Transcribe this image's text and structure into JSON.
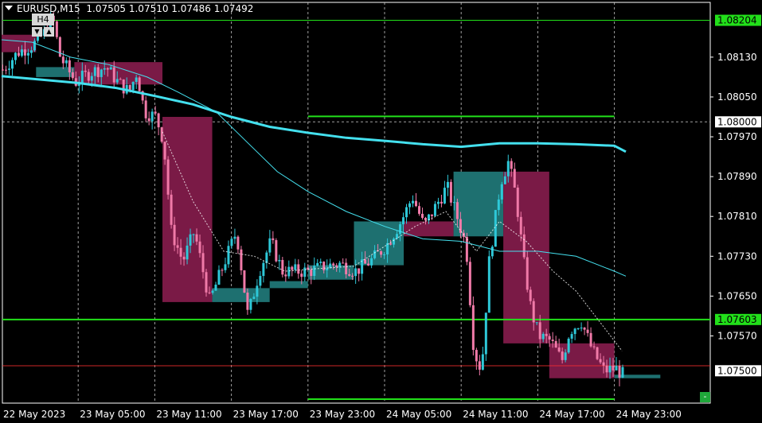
{
  "header": {
    "symbol": "EURUSD,M15",
    "ohlc": "1.07505 1.07510 1.07486 1.07492",
    "timeframe_box": "H4",
    "down_glyph": "▼",
    "up_glyph": "▲"
  },
  "minus_button": "-",
  "colors": {
    "background": "#000000",
    "grid": "#c8c8c8",
    "bull_candle": "#2ec8d8",
    "bear_candle": "#f07aa8",
    "bull_box": "#1e7070",
    "bear_box": "#7a1a46",
    "ma_slow": "#44e0ee",
    "level_line": "#22e01a",
    "level_label_bg": "#22e01a",
    "price_label_bg": "#ffffff",
    "ask_line": "#ff3030"
  },
  "chart_data": {
    "type": "candlestick",
    "ylim": [
      1.07435,
      1.0824
    ],
    "y_ticks": [
      "1.08130",
      "1.08050",
      "1.07970",
      "1.07890",
      "1.07810",
      "1.07730",
      "1.07650",
      "1.07570"
    ],
    "x_ticks": [
      "22 May 2023",
      "23 May 05:00",
      "23 May 11:00",
      "23 May 17:00",
      "23 May 23:00",
      "24 May 05:00",
      "24 May 11:00",
      "24 May 17:00",
      "24 May 23:00"
    ],
    "labels": [
      {
        "text": "1.08204",
        "value": 1.08204,
        "style": "green"
      },
      {
        "text": "1.08000",
        "value": 1.08,
        "style": "white"
      },
      {
        "text": "1.07603",
        "value": 1.07603,
        "style": "green"
      },
      {
        "text": "1.07500",
        "value": 1.075,
        "style": "white"
      }
    ],
    "horizontal_levels": [
      {
        "value": 1.08204,
        "from": 0.0,
        "to": 1.0,
        "width": 1
      },
      {
        "value": 1.07603,
        "from": 0.0,
        "to": 1.0,
        "width": 2
      },
      {
        "value": 1.08011,
        "from": 4.0,
        "to": 8.0,
        "width": 2
      },
      {
        "value": 1.07443,
        "from": 4.0,
        "to": 8.0,
        "width": 2
      }
    ],
    "ask_line": 1.0751,
    "h4_boxes": [
      {
        "x0": 0.0,
        "x1": 0.45,
        "open": 1.08175,
        "close": 1.0814,
        "dir": "down"
      },
      {
        "x0": 0.45,
        "x1": 0.95,
        "open": 1.0811,
        "close": 1.0809,
        "dir": "up"
      },
      {
        "x0": 0.95,
        "x1": 2.1,
        "open": 1.0812,
        "close": 1.08075,
        "dir": "down"
      },
      {
        "x0": 2.1,
        "x1": 2.75,
        "open": 1.0801,
        "close": 1.07638,
        "dir": "down"
      },
      {
        "x0": 2.75,
        "x1": 3.5,
        "open": 1.07638,
        "close": 1.07666,
        "dir": "up"
      },
      {
        "x0": 3.5,
        "x1": 4.0,
        "open": 1.07666,
        "close": 1.0768,
        "dir": "up"
      },
      {
        "x0": 4.0,
        "x1": 4.6,
        "open": 1.07683,
        "close": 1.07712,
        "dir": "up"
      },
      {
        "x0": 4.6,
        "x1": 5.25,
        "open": 1.07712,
        "close": 1.078,
        "dir": "up"
      },
      {
        "x0": 5.25,
        "x1": 5.9,
        "open": 1.078,
        "close": 1.0777,
        "dir": "down"
      },
      {
        "x0": 5.9,
        "x1": 6.55,
        "open": 1.0777,
        "close": 1.079,
        "dir": "up"
      },
      {
        "x0": 6.55,
        "x1": 7.15,
        "open": 1.079,
        "close": 1.07555,
        "dir": "down"
      },
      {
        "x0": 7.15,
        "x1": 8.0,
        "open": 1.07555,
        "close": 1.07485,
        "dir": "down"
      },
      {
        "x0": 8.0,
        "x1": 8.6,
        "open": 1.07485,
        "close": 1.07492,
        "dir": "up"
      }
    ],
    "candle_path": [
      [
        0.0,
        1.08105
      ],
      [
        0.2,
        1.0814
      ],
      [
        0.4,
        1.08155
      ],
      [
        0.55,
        1.0818
      ],
      [
        0.65,
        1.0821
      ],
      [
        0.75,
        1.0813
      ],
      [
        0.95,
        1.0808
      ],
      [
        1.15,
        1.081
      ],
      [
        1.35,
        1.0811
      ],
      [
        1.5,
        1.0808
      ],
      [
        1.65,
        1.0806
      ],
      [
        1.75,
        1.081
      ],
      [
        1.85,
        1.0802
      ],
      [
        2.0,
        1.0801
      ],
      [
        2.1,
        1.0796
      ],
      [
        2.2,
        1.0778
      ],
      [
        2.35,
        1.0772
      ],
      [
        2.5,
        1.0778
      ],
      [
        2.7,
        1.0764
      ],
      [
        2.9,
        1.0772
      ],
      [
        3.05,
        1.0778
      ],
      [
        3.2,
        1.0761
      ],
      [
        3.35,
        1.077
      ],
      [
        3.5,
        1.0776
      ],
      [
        3.65,
        1.077
      ],
      [
        3.8,
        1.077
      ],
      [
        4.0,
        1.077
      ],
      [
        4.2,
        1.0771
      ],
      [
        4.4,
        1.07715
      ],
      [
        4.6,
        1.077
      ],
      [
        4.8,
        1.0772
      ],
      [
        5.0,
        1.0775
      ],
      [
        5.2,
        1.078
      ],
      [
        5.35,
        1.0785
      ],
      [
        5.5,
        1.0779
      ],
      [
        5.65,
        1.0783
      ],
      [
        5.8,
        1.0787
      ],
      [
        5.95,
        1.078
      ],
      [
        6.05,
        1.0775
      ],
      [
        6.15,
        1.0754
      ],
      [
        6.25,
        1.075
      ],
      [
        6.35,
        1.0772
      ],
      [
        6.5,
        1.0788
      ],
      [
        6.6,
        1.0792
      ],
      [
        6.7,
        1.0785
      ],
      [
        6.8,
        1.0772
      ],
      [
        6.9,
        1.0762
      ],
      [
        7.0,
        1.0757
      ],
      [
        7.15,
        1.0756
      ],
      [
        7.3,
        1.0752
      ],
      [
        7.4,
        1.0758
      ],
      [
        7.55,
        1.076
      ],
      [
        7.7,
        1.0754
      ],
      [
        7.85,
        1.075
      ],
      [
        8.0,
        1.07505
      ],
      [
        8.1,
        1.07492
      ]
    ],
    "ma_slow": [
      [
        0.0,
        1.08092
      ],
      [
        0.5,
        1.08085
      ],
      [
        1.0,
        1.08078
      ],
      [
        1.5,
        1.08068
      ],
      [
        2.0,
        1.08052
      ],
      [
        2.5,
        1.08035
      ],
      [
        3.0,
        1.0801
      ],
      [
        3.5,
        1.0799
      ],
      [
        4.0,
        1.07978
      ],
      [
        4.5,
        1.07968
      ],
      [
        5.0,
        1.07962
      ],
      [
        5.5,
        1.07955
      ],
      [
        6.0,
        1.0795
      ],
      [
        6.5,
        1.07957
      ],
      [
        7.0,
        1.07957
      ],
      [
        7.5,
        1.07955
      ],
      [
        8.0,
        1.07952
      ],
      [
        8.15,
        1.0794
      ]
    ],
    "ma_fast": [
      [
        0.0,
        1.08165
      ],
      [
        0.4,
        1.0816
      ],
      [
        0.9,
        1.0813
      ],
      [
        1.4,
        1.08115
      ],
      [
        1.9,
        1.0809
      ],
      [
        2.3,
        1.0806
      ],
      [
        2.8,
        1.0802
      ],
      [
        3.2,
        1.0796
      ],
      [
        3.6,
        1.079
      ],
      [
        4.0,
        1.0786
      ],
      [
        4.5,
        1.0782
      ],
      [
        5.0,
        1.0779
      ],
      [
        5.5,
        1.07765
      ],
      [
        6.0,
        1.0776
      ],
      [
        6.5,
        1.0774
      ],
      [
        7.0,
        1.0774
      ],
      [
        7.5,
        1.0773
      ],
      [
        8.0,
        1.077
      ],
      [
        8.15,
        1.0769
      ]
    ],
    "ma_dashed": [
      [
        2.1,
        1.0798
      ],
      [
        2.5,
        1.0784
      ],
      [
        2.9,
        1.0774
      ],
      [
        3.3,
        1.0773
      ],
      [
        3.7,
        1.077
      ],
      [
        4.1,
        1.07705
      ],
      [
        4.6,
        1.0771
      ],
      [
        5.0,
        1.0775
      ],
      [
        5.4,
        1.0779
      ],
      [
        5.8,
        1.0782
      ],
      [
        6.2,
        1.0774
      ],
      [
        6.5,
        1.078
      ],
      [
        6.85,
        1.0776
      ],
      [
        7.2,
        1.077
      ],
      [
        7.5,
        1.0766
      ],
      [
        7.8,
        1.076
      ],
      [
        8.1,
        1.0754
      ]
    ]
  }
}
